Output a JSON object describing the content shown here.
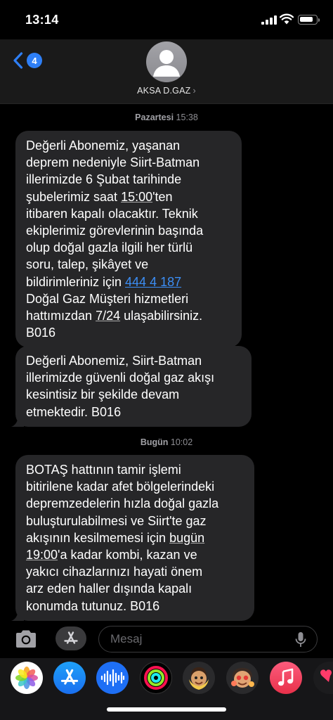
{
  "status_bar": {
    "time": "13:14",
    "battery_level": 0.8
  },
  "header": {
    "back_badge": "4",
    "contact_name": "AKSA D.GAZ",
    "contact_chevron": "›"
  },
  "conversation": [
    {
      "timestamp": {
        "day": "Pazartesi",
        "time": "15:38"
      },
      "messages": [
        {
          "segments": [
            {
              "text": "Değerli Abonemiz, yaşanan\ndeprem nedeniyle Siirt-Batman\nillerimizde 6 Şubat tarihinde\nşubelerimiz saat ",
              "style": "plain"
            },
            {
              "text": "15:00",
              "style": "underline"
            },
            {
              "text": "'ten\nitibaren kapalı olacaktır. Teknik\nekiplerimiz görevlerinin başında\nolup doğal gazla ilgili her türlü\nsoru, talep, şikâyet ve\nbildirimleriniz için ",
              "style": "plain"
            },
            {
              "text": "444 4 187",
              "style": "link"
            },
            {
              "text": "\nDoğal Gaz Müşteri hizmetleri\nhattımızdan ",
              "style": "plain"
            },
            {
              "text": "7/24",
              "style": "underline"
            },
            {
              "text": " ulaşabilirsiniz.\nB016",
              "style": "plain"
            }
          ]
        },
        {
          "segments": [
            {
              "text": "Değerli Abonemiz, Siirt-Batman\nillerimizde güvenli doğal gaz akışı\nkesintisiz bir şekilde devam\netmektedir. B016",
              "style": "plain"
            }
          ]
        }
      ]
    },
    {
      "timestamp": {
        "day": "Bugün",
        "time": "10:02"
      },
      "messages": [
        {
          "segments": [
            {
              "text": "BOTAŞ hattının tamir işlemi\nbitirilene kadar afet bölgelerindeki\ndepremzedelerin hızla doğal gazla\nbuluşturulabilmesi ve Siirt'te gaz\nakışının kesilmemesi için ",
              "style": "plain"
            },
            {
              "text": "bugün\n19:00",
              "style": "underline"
            },
            {
              "text": "'a kadar kombi, kazan ve\nyakıcı cihazlarınızı hayati önem\narz eden haller dışında kapalı\nkonumda tutunuz. B016",
              "style": "plain"
            }
          ]
        }
      ]
    }
  ],
  "composer": {
    "placeholder": "Mesaj"
  },
  "app_drawer": [
    {
      "name": "photos-app-icon"
    },
    {
      "name": "app-store-app-icon"
    },
    {
      "name": "audio-message-app-icon"
    },
    {
      "name": "fitness-activity-app-icon"
    },
    {
      "name": "memoji-app-icon"
    },
    {
      "name": "memoji-stickers-app-icon"
    },
    {
      "name": "music-app-icon"
    },
    {
      "name": "digital-touch-app-icon"
    }
  ]
}
